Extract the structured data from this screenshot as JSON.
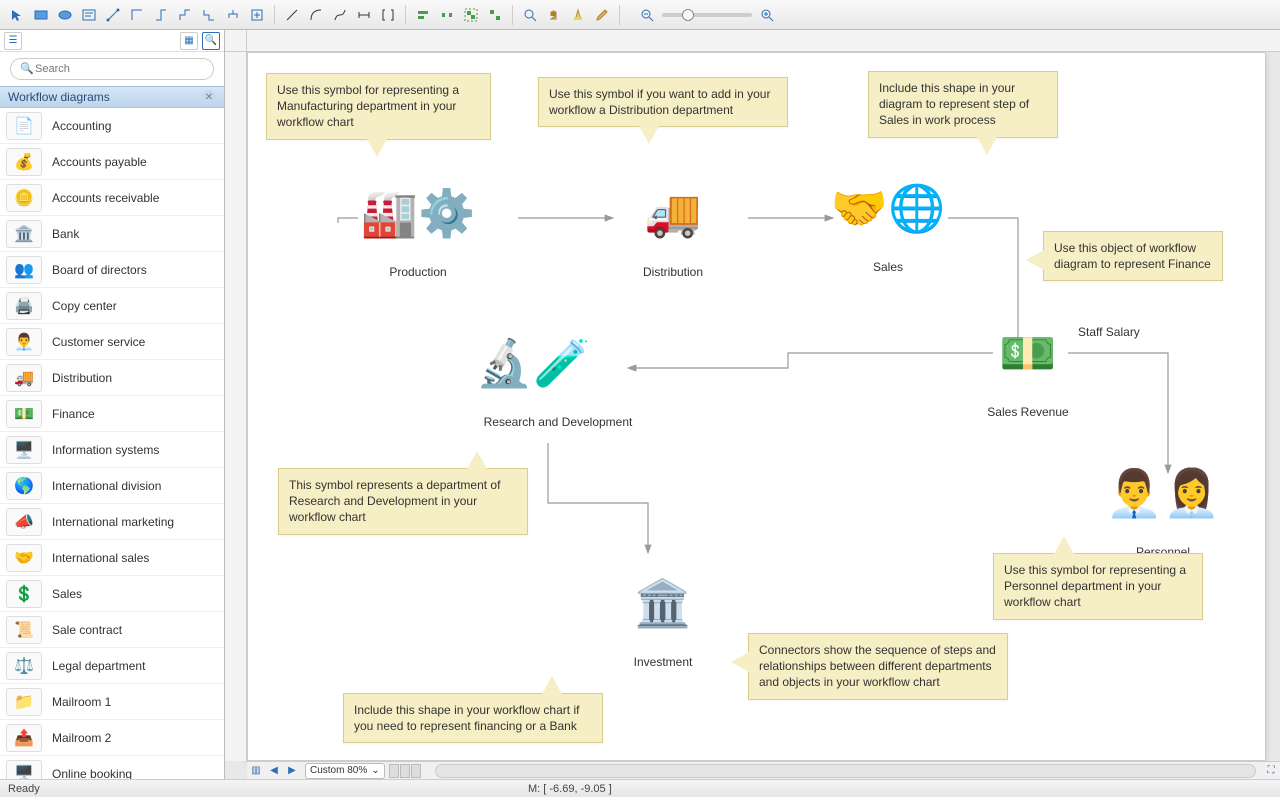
{
  "toolbar": {
    "tools_group1": [
      "pointer",
      "rect",
      "ellipse",
      "text",
      "connector",
      "polyline",
      "orthogonal",
      "step-up",
      "step-down",
      "tree",
      "insert"
    ],
    "tools_group2": [
      "line",
      "arc",
      "curve",
      "dimension",
      "brackets"
    ],
    "tools_group3": [
      "align",
      "distribute",
      "group",
      "ungroup"
    ],
    "tools_group4": [
      "zoom-in",
      "hand",
      "highlight",
      "edit"
    ]
  },
  "sidebar": {
    "search_placeholder": "Search",
    "section_title": "Workflow diagrams",
    "items": [
      {
        "label": "Accounting",
        "emoji": "📄"
      },
      {
        "label": "Accounts payable",
        "emoji": "💰"
      },
      {
        "label": "Accounts receivable",
        "emoji": "🪙"
      },
      {
        "label": "Bank",
        "emoji": "🏛️"
      },
      {
        "label": "Board of directors",
        "emoji": "👥"
      },
      {
        "label": "Copy center",
        "emoji": "🖨️"
      },
      {
        "label": "Customer service",
        "emoji": "👨‍💼"
      },
      {
        "label": "Distribution",
        "emoji": "🚚"
      },
      {
        "label": "Finance",
        "emoji": "💵"
      },
      {
        "label": "Information systems",
        "emoji": "🖥️"
      },
      {
        "label": "International division",
        "emoji": "🌎"
      },
      {
        "label": "International marketing",
        "emoji": "📣"
      },
      {
        "label": "International sales",
        "emoji": "🤝"
      },
      {
        "label": "Sales",
        "emoji": "💲"
      },
      {
        "label": "Sale contract",
        "emoji": "📜"
      },
      {
        "label": "Legal department",
        "emoji": "⚖️"
      },
      {
        "label": "Mailroom 1",
        "emoji": "📁"
      },
      {
        "label": "Mailroom 2",
        "emoji": "📤"
      },
      {
        "label": "Online booking",
        "emoji": "🖥️"
      }
    ]
  },
  "diagram": {
    "nodes": {
      "production": "Production",
      "distribution": "Distribution",
      "sales": "Sales",
      "research": "Research and Development",
      "revenue": "Sales Revenue",
      "staff_salary": "Staff Salary",
      "investment": "Investment",
      "personnel": "Personnel"
    },
    "callouts": {
      "production": "Use this symbol for representing a Manufacturing department in your workflow chart",
      "distribution": "Use this symbol if you want to add in your workflow a Distribution department",
      "sales": "Include this shape in your diagram to represent step of Sales in work process",
      "finance": "Use this object of workflow diagram to represent Finance",
      "research": "This symbol represents a department of Research and Development in your workflow chart",
      "personnel": "Use this symbol for representing a Personnel department in your workflow chart",
      "connectors": "Connectors show the sequence of steps and relationships between different departments and objects in your workflow chart",
      "bank": "Include this shape in your workflow chart if you need to represent financing or a Bank"
    }
  },
  "zoom": {
    "label": "Custom 80%"
  },
  "status": {
    "ready": "Ready",
    "mouse": "M: [ -6.69, -9.05 ]"
  }
}
